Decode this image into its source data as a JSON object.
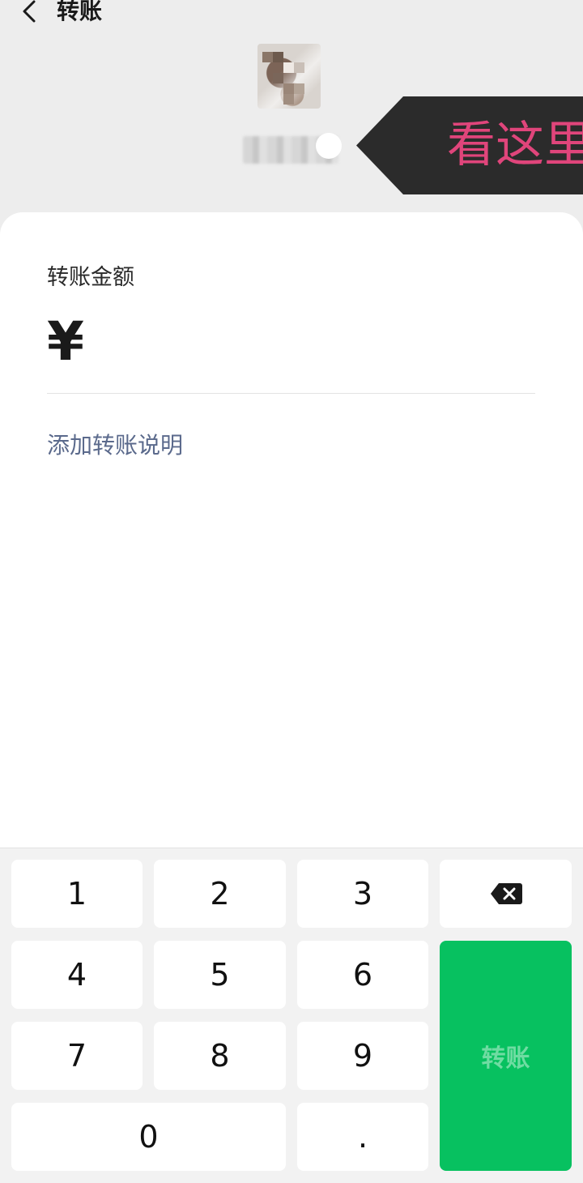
{
  "header": {
    "title": "转账",
    "back_icon": "chevron-left-icon"
  },
  "callout": {
    "text": "看这里",
    "bg_color": "#2b2b2b",
    "text_color": "#e0457b"
  },
  "form": {
    "amount_label": "转账金额",
    "currency_symbol": "¥",
    "amount_value": "",
    "add_note_label": "添加转账说明"
  },
  "keypad": {
    "keys": {
      "k1": "1",
      "k2": "2",
      "k3": "3",
      "k4": "4",
      "k5": "5",
      "k6": "6",
      "k7": "7",
      "k8": "8",
      "k9": "9",
      "k0": "0",
      "dot": "."
    },
    "backspace_icon": "backspace-icon",
    "transfer_label": "转账",
    "transfer_color": "#07c160"
  }
}
